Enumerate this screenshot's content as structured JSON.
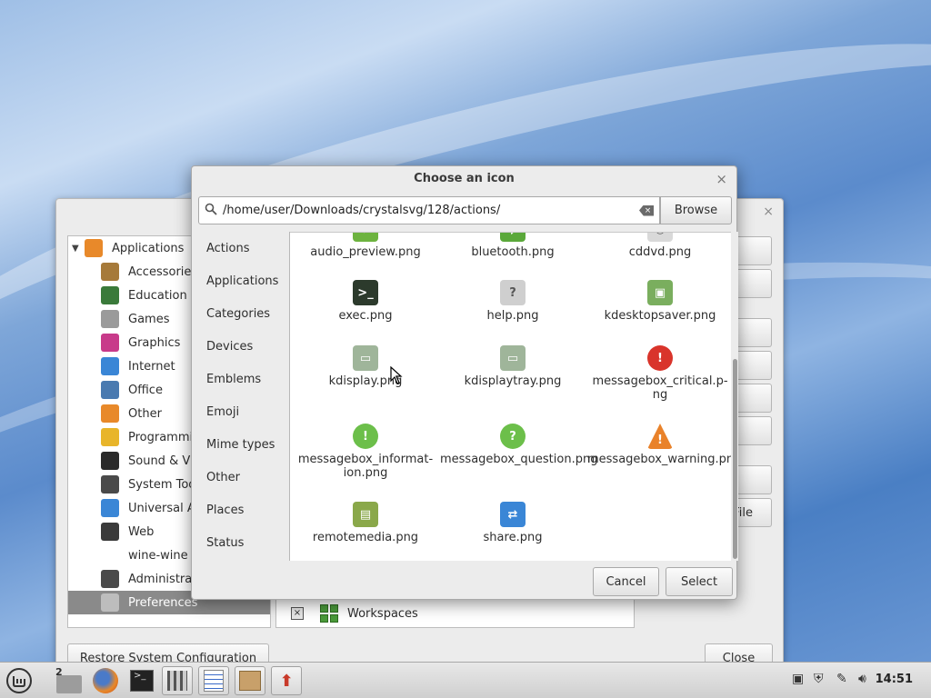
{
  "dialog": {
    "title": "Choose an icon",
    "close_glyph": "×",
    "path_value": "/home/user/Downloads/crystalsvg/128/actions/",
    "browse_label": "Browse",
    "cancel_label": "Cancel",
    "select_label": "Select",
    "categories": [
      "Actions",
      "Applications",
      "Categories",
      "Devices",
      "Emblems",
      "Emoji",
      "Mime types",
      "Other",
      "Places",
      "Status"
    ],
    "icons": [
      {
        "label": "audio_preview.png",
        "icon": "audio-icon",
        "color": "#6db33f"
      },
      {
        "label": "bluetooth.png",
        "icon": "bluetooth-icon",
        "color": "#5aa83a"
      },
      {
        "label": "cddvd.png",
        "icon": "disc-icon",
        "color": "#d9d9d9"
      },
      {
        "label": "exec.png",
        "icon": "terminal-icon",
        "color": "#2c3a2c"
      },
      {
        "label": "help.png",
        "icon": "help-icon",
        "color": "#cfcfcf"
      },
      {
        "label": "kdesktopsaver.png",
        "icon": "screensaver-lock-icon",
        "color": "#7aae5e"
      },
      {
        "label": "kdisplay.png",
        "icon": "monitor-icon",
        "color": "#9fb59a"
      },
      {
        "label": "kdisplaytray.png",
        "icon": "monitor-tray-icon",
        "color": "#9fb59a"
      },
      {
        "label": "messagebox_critical.p-ng",
        "icon": "critical-icon",
        "color": "#d9342b"
      },
      {
        "label": "messagebox_informat-ion.png",
        "icon": "info-icon",
        "color": "#6cbf4a"
      },
      {
        "label": "messagebox_question.png",
        "icon": "question-icon",
        "color": "#6cbf4a"
      },
      {
        "label": "messagebox_warning.png",
        "icon": "warning-icon",
        "color": "#e9822a"
      },
      {
        "label": "remotemedia.png",
        "icon": "remote-media-icon",
        "color": "#8aa84a"
      },
      {
        "label": "share.png",
        "icon": "share-icon",
        "color": "#3a86d6"
      }
    ]
  },
  "background_window": {
    "tree": [
      {
        "label": "Applications",
        "root": true,
        "icon": "applications-icon",
        "color": "#e8892a"
      },
      {
        "label": "Accessories",
        "icon": "accessories-icon",
        "color": "#a67a3a"
      },
      {
        "label": "Education",
        "icon": "education-icon",
        "color": "#3a7a3a"
      },
      {
        "label": "Games",
        "icon": "games-icon",
        "color": "#9a9a9a"
      },
      {
        "label": "Graphics",
        "icon": "graphics-icon",
        "color": "#c83a8a"
      },
      {
        "label": "Internet",
        "icon": "internet-icon",
        "color": "#3a86d6"
      },
      {
        "label": "Office",
        "icon": "office-icon",
        "color": "#4a7ab0"
      },
      {
        "label": "Other",
        "icon": "other-icon",
        "color": "#e8892a"
      },
      {
        "label": "Programmi",
        "icon": "programming-icon",
        "color": "#e8b52a"
      },
      {
        "label": "Sound & Vi",
        "icon": "sound-video-icon",
        "color": "#2a2a2a"
      },
      {
        "label": "System Too",
        "icon": "system-tools-icon",
        "color": "#4a4a4a"
      },
      {
        "label": "Universal A",
        "icon": "universal-access-icon",
        "color": "#3a86d6"
      },
      {
        "label": "Web",
        "icon": "web-icon",
        "color": "#3a3a3a"
      },
      {
        "label": "wine-wine",
        "icon": "blank",
        "color": "transparent"
      },
      {
        "label": "Administrat",
        "icon": "administration-icon",
        "color": "#4a4a4a"
      },
      {
        "label": "Preferences",
        "icon": "preferences-icon",
        "color": "#bdbdbd",
        "selected": true
      }
    ],
    "workspaces_label": "Workspaces",
    "checkbox_glyph": "×",
    "side_button_partial_label": "File",
    "restore_label": "Restore System Configuration",
    "close_label": "Close"
  },
  "taskbar": {
    "workspace_number": "2",
    "clock": "14:51"
  }
}
